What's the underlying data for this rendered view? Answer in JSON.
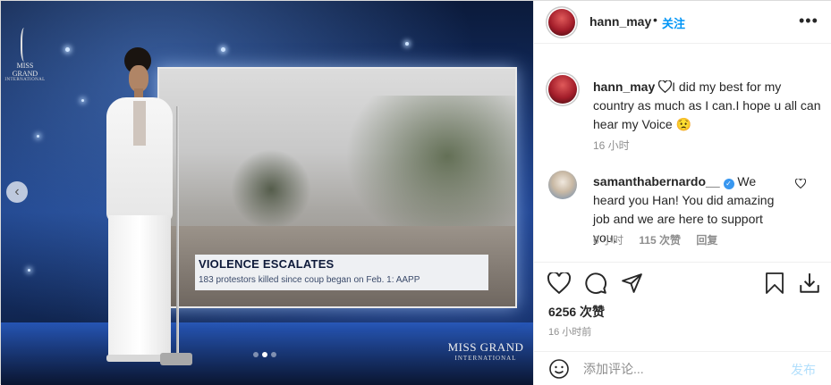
{
  "post": {
    "username": "hann_may",
    "follow_sep": "•",
    "follow_label": "关注",
    "more_label": "•••"
  },
  "media": {
    "banner_title": "VIOLENCE ESCALATES",
    "banner_sub": "183 protestors killed since coup began on Feb. 1: AAPP",
    "logo_top": "MISS GRAND",
    "logo_top_sub": "INTERNATIONAL",
    "logo_bottom": "MISS GRAND",
    "logo_bottom_sub": "INTERNATIONAL",
    "nav_prev": "‹",
    "carousel_index": 2,
    "carousel_count": 3
  },
  "caption": {
    "username": "hann_may",
    "text": "I did my best for my country as much as I can.I hope u all can hear my Voice",
    "emoji": "😟",
    "time": "16 小时"
  },
  "comment": {
    "username": "samanthabernardo__",
    "text": "We heard you Han! You did amazing job and we are here to support you.",
    "time": "6 小时",
    "likes": "115 次赞",
    "reply": "回复"
  },
  "stats": {
    "likes": "6256 次赞",
    "date": "16 小时前"
  },
  "add_comment": {
    "placeholder": "添加评论...",
    "post_label": "发布"
  },
  "colors": {
    "link_blue": "#0095f6",
    "post_disabled": "#b2dffc",
    "verified": "#3897f0"
  },
  "icons": [
    "heart-icon",
    "comment-icon",
    "share-icon",
    "bookmark-icon",
    "download-icon",
    "emoji-icon",
    "verified-icon",
    "more-icon"
  ]
}
